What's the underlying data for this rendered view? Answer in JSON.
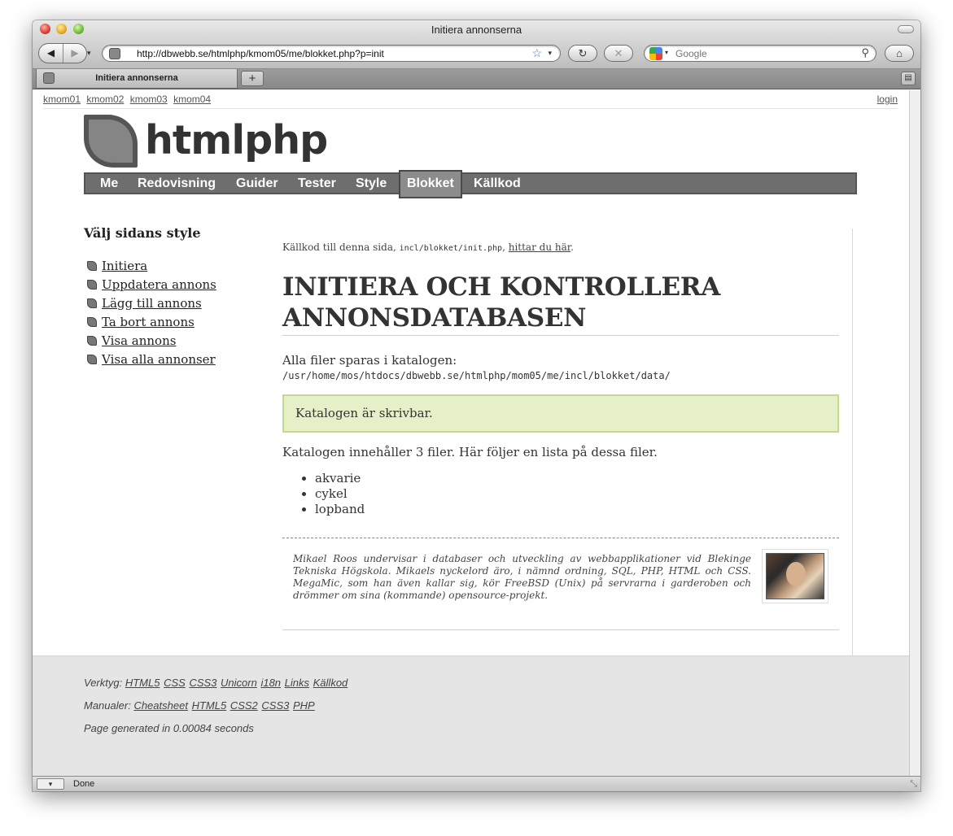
{
  "browser": {
    "window_title": "Initiera annonserna",
    "url": "http://dbwebb.se/htmlphp/kmom05/me/blokket.php?p=init",
    "search_placeholder": "Google",
    "tab_title": "Initiera annonserna",
    "tab_add": "+",
    "status": "Done",
    "icons": {
      "back": "◀",
      "forward": "▶",
      "dropdown": "▾",
      "bookmark_star": "☆",
      "reload": "↻",
      "stop": "✕",
      "search": "⚲",
      "home": "⌂",
      "tab_menu": "▤",
      "resize": "⤡"
    }
  },
  "site": {
    "top_links": [
      "kmom01",
      "kmom02",
      "kmom03",
      "kmom04"
    ],
    "login": "login",
    "logo_text": "htmlphp",
    "nav": [
      "Me",
      "Redovisning",
      "Guider",
      "Tester",
      "Style",
      "Blokket",
      "Källkod"
    ],
    "nav_active": "Blokket"
  },
  "sidebar": {
    "title": "Välj sidans style",
    "items": [
      "Initiera",
      "Uppdatera annons",
      "Lägg till annons",
      "Ta bort annons",
      "Visa annons",
      "Visa alla annonser"
    ]
  },
  "main": {
    "source_prefix": "Källkod till denna sida,",
    "source_file": "incl/blokket/init.php",
    "source_sep": ",",
    "source_link": "hittar du här",
    "source_suffix": ".",
    "title_line1": "INITIERA OCH KONTROLLERA",
    "title_line2": "ANNONSDATABASEN",
    "files_intro": "Alla filer sparas i katalogen:",
    "files_path": "/usr/home/mos/htdocs/dbwebb.se/htmlphp/mom05/me/incl/blokket/data/",
    "writable_msg": "Katalogen är skrivbar.",
    "count_msg": "Katalogen innehåller 3 filer. Här följer en lista på dessa filer.",
    "files": [
      "akvarie",
      "cykel",
      "lopband"
    ],
    "bio": "Mikael Roos undervisar i databaser och utveckling av webbapplikationer vid Blekinge Tekniska Högskola. Mikaels nyckelord äro, i nämnd ordning, SQL, PHP, HTML och CSS. MegaMic, som han även kallar sig, kör FreeBSD (Unix) på servrarna i garderoben och drömmer om sina (kommande) opensource-projekt."
  },
  "footer": {
    "tools_label": "Verktyg:",
    "tools": [
      "HTML5",
      "CSS",
      "CSS3",
      "Unicorn",
      "i18n",
      "Links",
      "Källkod"
    ],
    "manuals_label": "Manualer:",
    "manuals": [
      "Cheatsheet",
      "HTML5",
      "CSS2",
      "CSS3",
      "PHP"
    ],
    "generated": "Page generated in 0.00084 seconds"
  }
}
